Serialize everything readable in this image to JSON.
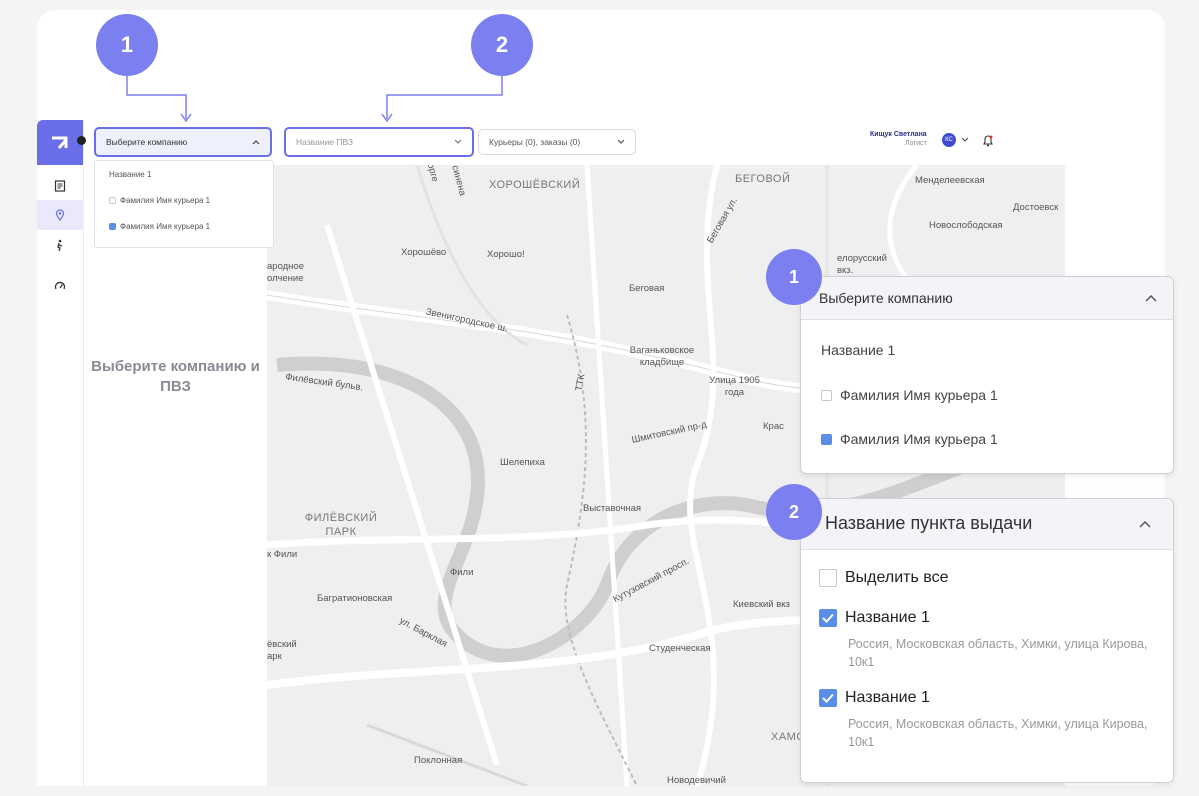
{
  "header": {
    "company_placeholder": "Выберите компанию",
    "pvz_placeholder": "Название ПВЗ",
    "couriers_label": "Курьеры (0), заказы (0)"
  },
  "user": {
    "name": "Кищук Светлана",
    "role": "Логист",
    "initials": "КС"
  },
  "company_dropdown": {
    "company_name": "Название 1",
    "couriers": [
      {
        "label": "Фамилия Имя курьера 1",
        "checked": false
      },
      {
        "label": "Фамилия Имя курьера 1",
        "checked": true
      }
    ]
  },
  "left_panel": {
    "message": "Выберите компанию и ПВЗ"
  },
  "badges": {
    "one": "1",
    "two": "2"
  },
  "zoom_company": {
    "title": "Выберите компанию",
    "company_name": "Название 1",
    "couriers": [
      {
        "label": "Фамилия Имя курьера 1",
        "checked": false
      },
      {
        "label": "Фамилия Имя курьера 1",
        "checked": true
      }
    ]
  },
  "zoom_pvz": {
    "title": "Название пункта выдачи",
    "select_all": "Выделить все",
    "items": [
      {
        "name": "Название 1",
        "address": "Россия, Московская область, Химки, улица Кирова, 10к1",
        "checked": true
      },
      {
        "name": "Название 1",
        "address": "Россия, Московская область, Химки, улица Кирова, 10к1",
        "checked": true
      }
    ]
  },
  "map_labels": {
    "khoroshevsky": "ХОРОШЁВСКИЙ",
    "begovoy": "БЕГОВОЙ",
    "mendeleevskaya": "Менделеевская",
    "dostoevskaya": "Достоевск",
    "novoslobodskaya": "Новослободская",
    "belorussky": "елорусский вкз.",
    "khoroshevo": "Хорошёво",
    "khorosho": "Хорошо!",
    "narodnoe": "ародное олчение",
    "begovaya": "Беговая",
    "begovaya_ul": "Беговая ул.",
    "zvenigorodskoe": "Звенигородское ш.",
    "vagankovskoe": "Ваганьковское кладбище",
    "ulitsa1905": "Улица 1905 года",
    "filevsky_bulvar": "Филёвский бульв.",
    "ttk": "ТТК",
    "shmitovsky": "Шмитовский пр-д",
    "kras": "Крас",
    "shelepikha": "Шелепиха",
    "vystavochnaya": "Выставочная",
    "filevsky_park": "ФИЛЁВСКИЙ ПАРК",
    "fili_left": "к Фили",
    "fili": "Фили",
    "kutuzovsky": "Кутузовский просп.",
    "kievsky": "Киевский вкз",
    "bagrationovskaya": "Багратионовская",
    "barklaya": "ул. Барклая",
    "studencheskaya": "Студенческая",
    "evsky_park": "ёвский арк",
    "poklonnaya": "Поклонная",
    "khamo": "ХАМО",
    "novodevichy": "Новодевичий",
    "orge": "орге",
    "sinena": "синена"
  }
}
